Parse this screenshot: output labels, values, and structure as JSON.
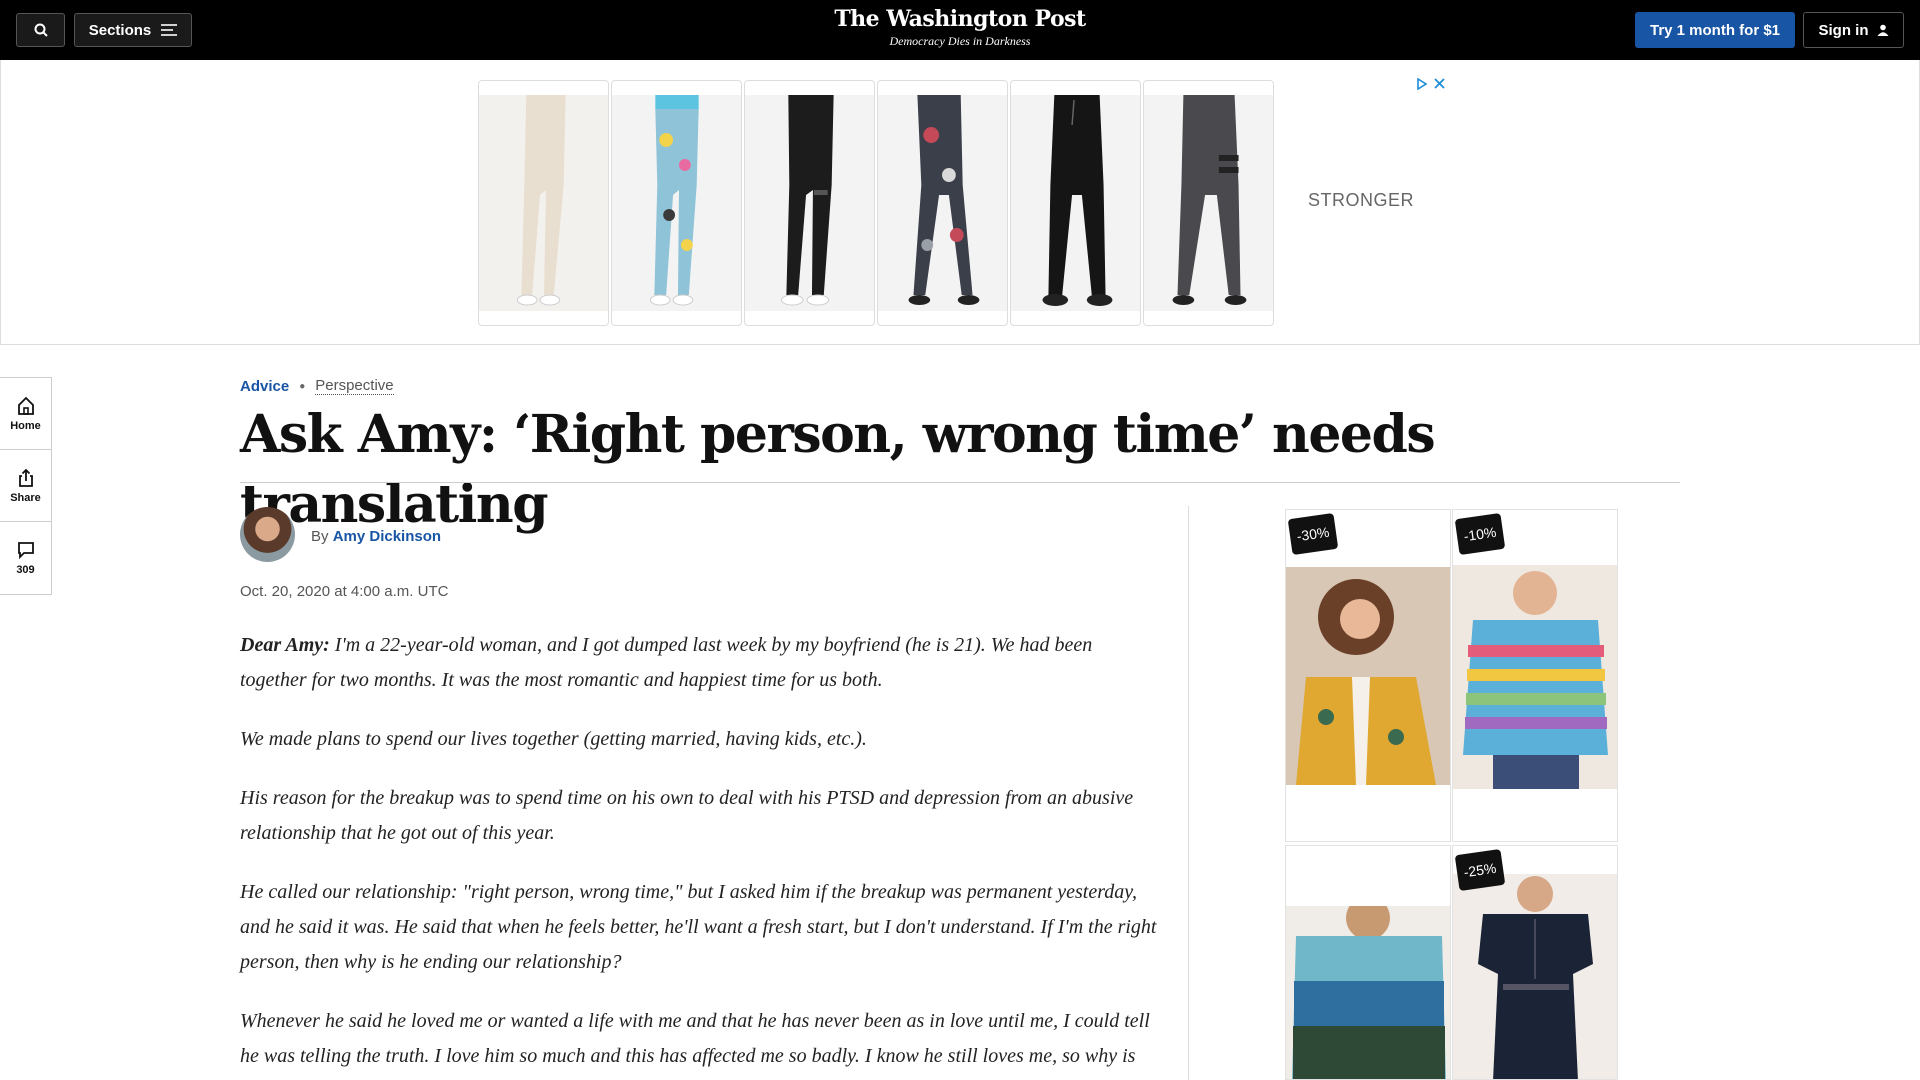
{
  "topbar": {
    "sections_label": "Sections",
    "brand_name": "The Washington Post",
    "brand_tagline": "Democracy Dies in Darkness",
    "try_label": "Try 1 month for $1",
    "signin_label": "Sign in"
  },
  "top_ad": {
    "side_text": "STRONGER",
    "tiles": [
      "cream-leggings",
      "printed-leggings",
      "black-striped-leggings",
      "camo-leggings",
      "black-joggers",
      "grey-striped-leggings"
    ]
  },
  "rail": {
    "home_label": "Home",
    "share_label": "Share",
    "comments_count": "309"
  },
  "article": {
    "kicker_section": "Advice",
    "kicker_type": "Perspective",
    "headline": "Ask Amy: ‘Right person, wrong time’ needs translating",
    "byline_prefix": "By",
    "author": "Amy Dickinson",
    "date": "Oct. 20, 2020 at 4:00 a.m. UTC",
    "salutation": "Dear Amy:",
    "p1": " I'm a 22-year-old woman, and I got dumped last week by my boyfriend (he is 21). We had been together for two months. It was the most romantic and happiest time for us both.",
    "p2": "We made plans to spend our lives together (getting married, having kids, etc.).",
    "p3": "His reason for the breakup was to spend time on his own to deal with his PTSD and depression from an abusive relationship that he got out of this year.",
    "p4": "He called our relationship: \"right person, wrong time,\" but I asked him if the breakup was permanent yesterday, and he said it was. He said that when he feels better, he'll want a fresh start, but I don't understand. If I'm the right person, then why is he ending our relationship?",
    "p5": "Whenever he said he loved me or wanted a life with me and that he has never been as in love until me, I could tell he was telling the truth. I love him so much and this has affected me so badly. I know he still loves me, so why is"
  },
  "right_ad": {
    "badge1": "-30%",
    "badge2": "-10%",
    "badge3": "-25%"
  }
}
